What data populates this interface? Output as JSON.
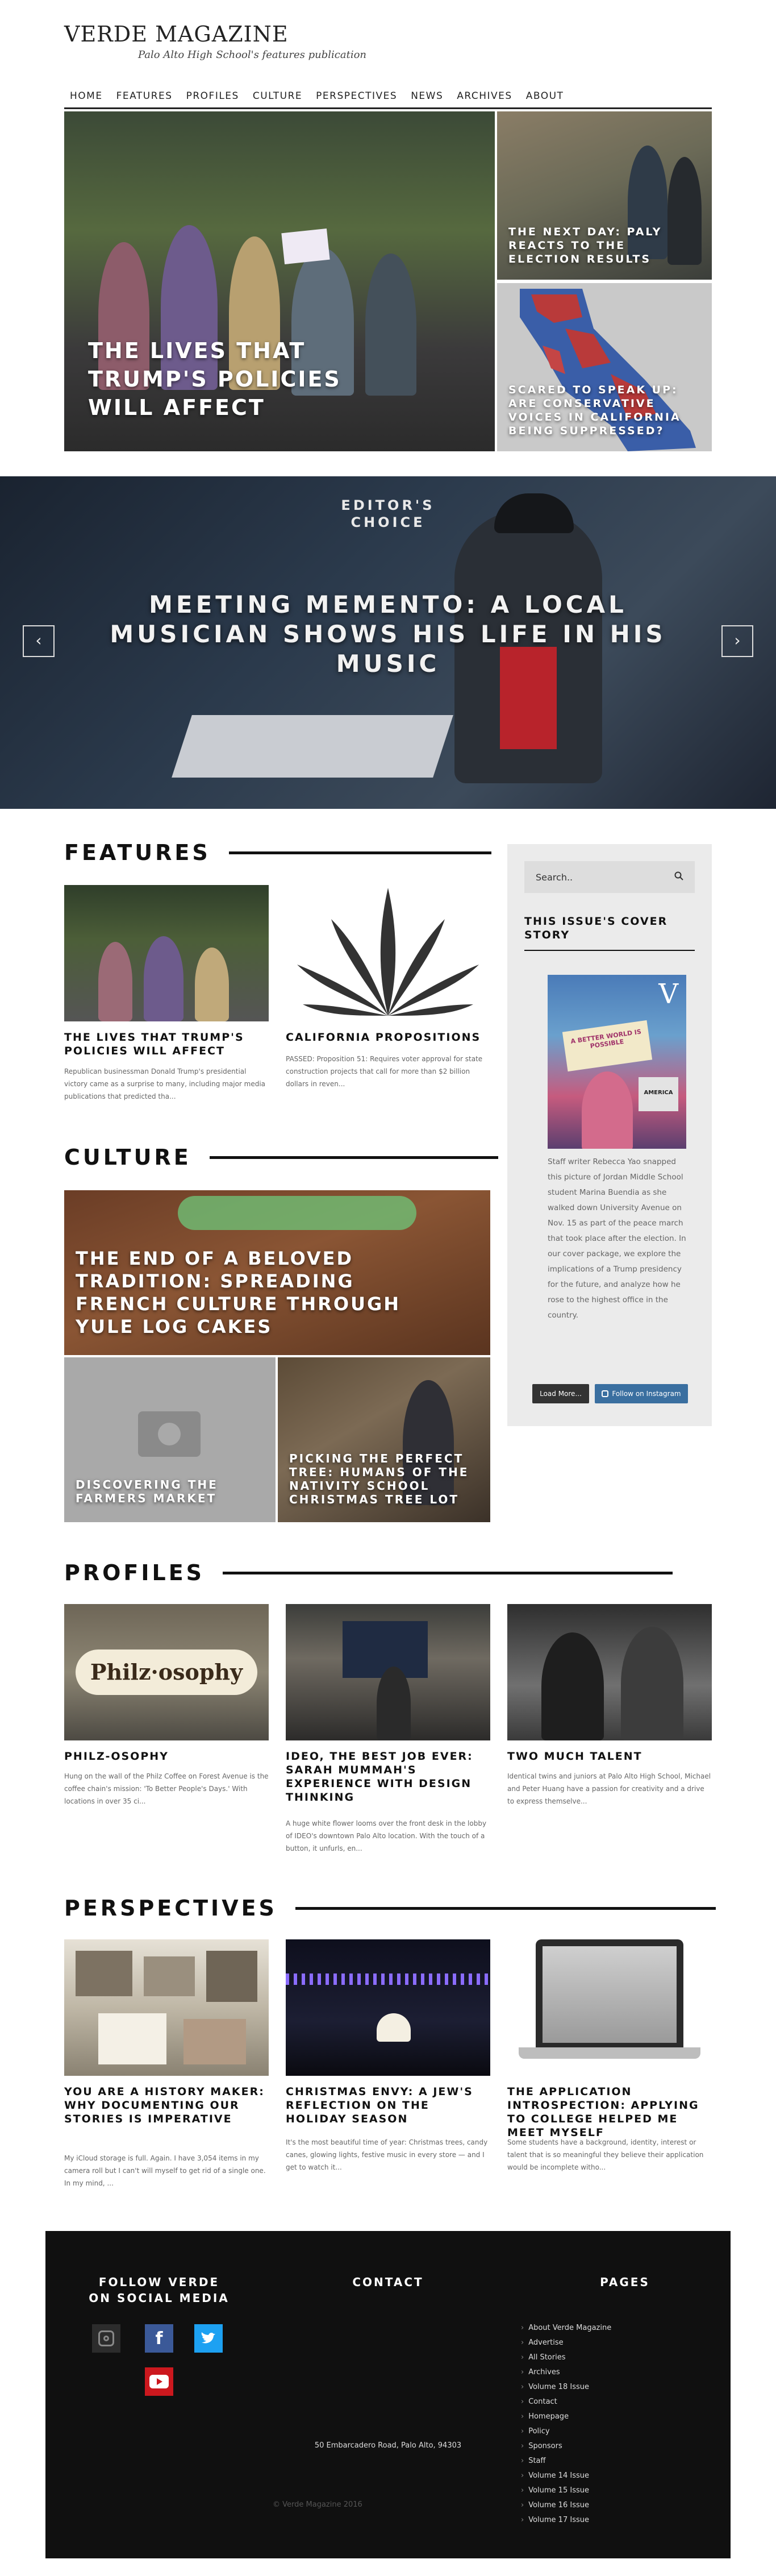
{
  "header": {
    "logo": "VERDE MAGAZINE",
    "tagline": "Palo Alto High School's features publication"
  },
  "nav": [
    "HOME",
    "FEATURES",
    "PROFILES",
    "CULTURE",
    "PERSPECTIVES",
    "NEWS",
    "ARCHIVES",
    "ABOUT"
  ],
  "hero": {
    "main_title": "THE LIVES THAT TRUMP'S POLICIES WILL AFFECT",
    "side1_title": "THE NEXT DAY: PALY REACTS TO THE ELECTION RESULTS",
    "side2_title": "SCARED TO SPEAK UP: ARE CONSERVATIVE VOICES IN CALIFORNIA BEING SUPPRESSED?"
  },
  "editors_choice": {
    "label": "EDITOR'S CHOICE",
    "title": "MEETING MEMENTO: A LOCAL MUSICIAN SHOWS HIS LIFE IN HIS MUSIC",
    "prev": "‹",
    "next": "›"
  },
  "features": {
    "heading": "FEATURES",
    "items": [
      {
        "title": "THE LIVES THAT TRUMP'S POLICIES WILL AFFECT",
        "excerpt": "Republican businessman Donald Trump's presidential victory came as a surprise to many, including major media publications that predicted tha..."
      },
      {
        "title": "CALIFORNIA PROPOSITIONS",
        "excerpt": "PASSED: Proposition 51: Requires voter approval for state construction projects that call for more than $2 billion dollars in reven..."
      }
    ]
  },
  "culture": {
    "heading": "CULTURE",
    "main_title": "THE END OF A BELOVED TRADITION: SPREADING FRENCH CULTURE THROUGH YULE LOG CAKES",
    "small1_title": "DISCOVERING THE FARMERS MARKET",
    "small2_title": "PICKING THE PERFECT TREE: HUMANS OF THE NATIVITY SCHOOL CHRISTMAS TREE LOT"
  },
  "profiles": {
    "heading": "PROFILES",
    "items": [
      {
        "title": "PHILZ-OSOPHY",
        "excerpt": "Hung on the wall of the Philz Coffee on Forest Avenue is the coffee chain's mission: 'To Better People's Days.' With locations in over 35 ci..."
      },
      {
        "title": "IDEO, THE BEST JOB EVER: SARAH MUMMAH'S EXPERIENCE WITH DESIGN THINKING",
        "excerpt": "A huge white flower looms over the front desk in the lobby of IDEO's downtown Palo Alto location. With the touch of a button, it unfurls, en..."
      },
      {
        "title": "TWO MUCH TALENT",
        "excerpt": "Identical twins and juniors at Palo Alto High School, Michael and Peter Huang have a passion for creativity and a drive to express themselve..."
      }
    ],
    "sign_text": "Philz·osophy"
  },
  "perspectives": {
    "heading": "PERSPECTIVES",
    "items": [
      {
        "title": "YOU ARE A HISTORY MAKER: WHY DOCUMENTING OUR STORIES IS IMPERATIVE",
        "excerpt": "My iCloud storage is full. Again. I have 3,054 items in my camera roll but I can't will myself to get rid of a single one. In my mind, ..."
      },
      {
        "title": "CHRISTMAS ENVY: A JEW'S REFLECTION ON THE HOLIDAY SEASON",
        "excerpt": "It's the most beautiful time of year: Christmas trees, candy canes, glowing lights, festive music in every store — and I get to watch it..."
      },
      {
        "title": "THE APPLICATION INTROSPECTION: APPLYING TO COLLEGE HELPED ME MEET MYSELF",
        "excerpt": "Some students have a background, identity, interest or talent that is so meaningful they believe their application would be incomplete witho..."
      }
    ]
  },
  "sidebar": {
    "search_placeholder": "Search..",
    "cover_heading": "THIS ISSUE'S COVER STORY",
    "cover_masthead": "V",
    "cover_sign1": "A BETTER WORLD IS POSSIBLE",
    "cover_sign2": "AMERICA",
    "cover_desc": "Staff writer Rebecca Yao snapped this picture of Jordan Middle School student Marina Buendia as she walked down University Avenue on Nov. 15 as part of the peace march that took place after the election. In our cover package, we explore the implications of a Trump presidency for the future, and analyze how he rose to the highest office in the country.",
    "load_more": "Load More...",
    "follow_ig": "Follow on Instagram"
  },
  "footer": {
    "social_heading": "FOLLOW VERDE ON SOCIAL MEDIA",
    "contact_heading": "CONTACT",
    "pages_heading": "PAGES",
    "address": "50 Embarcadero Road, Palo Alto, 94303",
    "copyright": "© Verde Magazine 2016",
    "pages": [
      "About Verde Magazine",
      "Advertise",
      "All Stories",
      "Archives",
      "Volume 18 Issue",
      "Contact",
      "Homepage",
      "Policy",
      "Sponsors",
      "Staff",
      "Volume 14 Issue",
      "Volume 15 Issue",
      "Volume 16 Issue",
      "Volume 17 Issue"
    ]
  },
  "colors": {
    "accent_dark": "#111111",
    "footer_bg": "#101010",
    "sidebar_bg": "#ebebeb",
    "instagram_blue": "#3a6fa0",
    "facebook_blue": "#3b5998",
    "twitter_blue": "#1da1f2",
    "youtube_red": "#cc181e"
  }
}
